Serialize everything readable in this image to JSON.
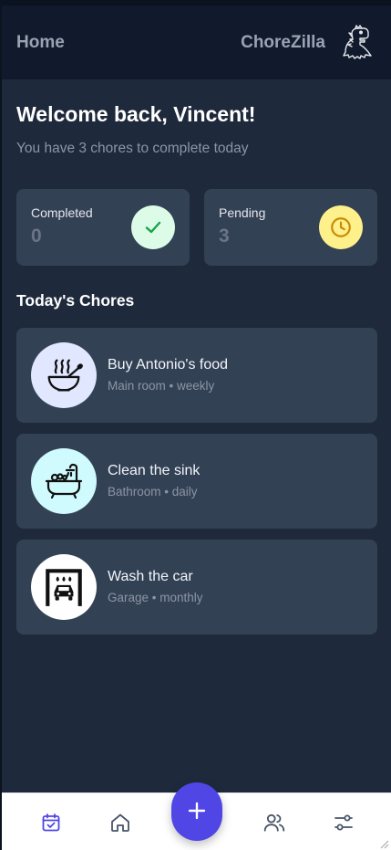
{
  "header": {
    "title": "Home",
    "brand": "ChoreZilla",
    "mascot_icon": "dinosaur-icon"
  },
  "welcome": {
    "heading": "Welcome back, Vincent!",
    "subtitle": "You have 3 chores to complete today"
  },
  "stats": [
    {
      "label": "Completed",
      "value": "0",
      "icon": "check-icon",
      "icon_color": "#16a34a",
      "bg": "#dcfce7"
    },
    {
      "label": "Pending",
      "value": "3",
      "icon": "clock-icon",
      "icon_color": "#ca8a04",
      "bg": "#fef08a"
    }
  ],
  "section": {
    "title": "Today's Chores"
  },
  "chores": [
    {
      "name": "Buy Antonio's food",
      "meta": "Main room • weekly",
      "icon": "bowl-icon",
      "icon_bg": "#e0e7ff"
    },
    {
      "name": "Clean the sink",
      "meta": "Bathroom • daily",
      "icon": "bathtub-icon",
      "icon_bg": "#cffafe"
    },
    {
      "name": "Wash the car",
      "meta": "Garage • monthly",
      "icon": "car-wash-icon",
      "icon_bg": "#ffffff"
    }
  ],
  "nav": {
    "items": [
      "calendar-check-icon",
      "home-icon",
      "add-icon",
      "users-icon",
      "settings-sliders-icon"
    ],
    "active_color": "#4f46e5",
    "inactive_color": "#475569"
  },
  "colors": {
    "background": "#1e293b",
    "card": "#334155",
    "header": "#111a2c",
    "accent": "#4f46e5"
  }
}
